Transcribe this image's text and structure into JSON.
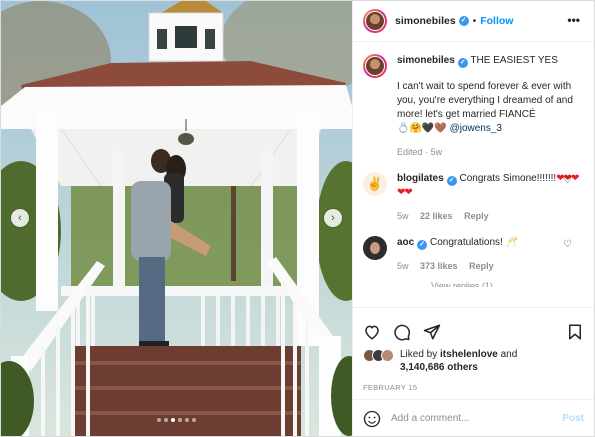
{
  "header": {
    "username": "simonebiles",
    "follow_label": "Follow",
    "separator": "•",
    "more": "•••"
  },
  "caption": {
    "username": "simonebiles",
    "title": "THE EASIEST YES",
    "body": "I can't wait to spend forever & ever with you, you're everything I dreamed of and more! let's get married FIANCÉ",
    "emojis": "💍🤗🖤🤎",
    "mention": "@jowens_3",
    "edited": "Edited",
    "age": "5w"
  },
  "comments": [
    {
      "username": "blogilates",
      "text": "Congrats Simone!!!!!!!",
      "hearts": "❤❤❤❤❤",
      "age": "5w",
      "likes": "22 likes",
      "reply": "Reply"
    },
    {
      "username": "aoc",
      "text": "Congratulations! 🥂",
      "age": "5w",
      "likes": "373 likes",
      "reply": "Reply"
    }
  ],
  "view_replies": "View replies (1)",
  "likes": {
    "prefix": "Liked by",
    "user": "itshelenlove",
    "and": "and",
    "count": "3,140,686 others"
  },
  "date": "FEBRUARY 15",
  "add_comment": {
    "placeholder": "Add a comment...",
    "post": "Post"
  },
  "carousel": {
    "prev": "‹",
    "next": "›",
    "count": 6,
    "active_index": 2
  },
  "icons": [
    "heart-icon",
    "comment-icon",
    "share-icon",
    "bookmark-icon",
    "emoji-icon",
    "verified-icon",
    "chevron-left-icon",
    "chevron-right-icon",
    "more-icon"
  ],
  "colors": {
    "accent": "#0095f6",
    "verified": "#3897f0",
    "muted": "#8e8e8e",
    "post_disabled": "#b2dffc",
    "heart_red": "#ed1c24"
  }
}
